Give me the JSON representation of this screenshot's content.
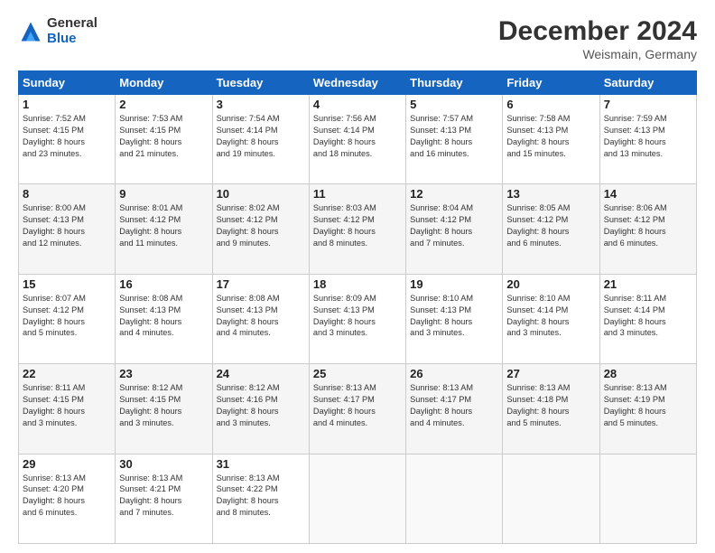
{
  "header": {
    "logo_general": "General",
    "logo_blue": "Blue",
    "month_title": "December 2024",
    "subtitle": "Weismain, Germany"
  },
  "days_of_week": [
    "Sunday",
    "Monday",
    "Tuesday",
    "Wednesday",
    "Thursday",
    "Friday",
    "Saturday"
  ],
  "weeks": [
    [
      {
        "day": "1",
        "lines": [
          "Sunrise: 7:52 AM",
          "Sunset: 4:15 PM",
          "Daylight: 8 hours",
          "and 23 minutes."
        ]
      },
      {
        "day": "2",
        "lines": [
          "Sunrise: 7:53 AM",
          "Sunset: 4:15 PM",
          "Daylight: 8 hours",
          "and 21 minutes."
        ]
      },
      {
        "day": "3",
        "lines": [
          "Sunrise: 7:54 AM",
          "Sunset: 4:14 PM",
          "Daylight: 8 hours",
          "and 19 minutes."
        ]
      },
      {
        "day": "4",
        "lines": [
          "Sunrise: 7:56 AM",
          "Sunset: 4:14 PM",
          "Daylight: 8 hours",
          "and 18 minutes."
        ]
      },
      {
        "day": "5",
        "lines": [
          "Sunrise: 7:57 AM",
          "Sunset: 4:13 PM",
          "Daylight: 8 hours",
          "and 16 minutes."
        ]
      },
      {
        "day": "6",
        "lines": [
          "Sunrise: 7:58 AM",
          "Sunset: 4:13 PM",
          "Daylight: 8 hours",
          "and 15 minutes."
        ]
      },
      {
        "day": "7",
        "lines": [
          "Sunrise: 7:59 AM",
          "Sunset: 4:13 PM",
          "Daylight: 8 hours",
          "and 13 minutes."
        ]
      }
    ],
    [
      {
        "day": "8",
        "lines": [
          "Sunrise: 8:00 AM",
          "Sunset: 4:13 PM",
          "Daylight: 8 hours",
          "and 12 minutes."
        ]
      },
      {
        "day": "9",
        "lines": [
          "Sunrise: 8:01 AM",
          "Sunset: 4:12 PM",
          "Daylight: 8 hours",
          "and 11 minutes."
        ]
      },
      {
        "day": "10",
        "lines": [
          "Sunrise: 8:02 AM",
          "Sunset: 4:12 PM",
          "Daylight: 8 hours",
          "and 9 minutes."
        ]
      },
      {
        "day": "11",
        "lines": [
          "Sunrise: 8:03 AM",
          "Sunset: 4:12 PM",
          "Daylight: 8 hours",
          "and 8 minutes."
        ]
      },
      {
        "day": "12",
        "lines": [
          "Sunrise: 8:04 AM",
          "Sunset: 4:12 PM",
          "Daylight: 8 hours",
          "and 7 minutes."
        ]
      },
      {
        "day": "13",
        "lines": [
          "Sunrise: 8:05 AM",
          "Sunset: 4:12 PM",
          "Daylight: 8 hours",
          "and 6 minutes."
        ]
      },
      {
        "day": "14",
        "lines": [
          "Sunrise: 8:06 AM",
          "Sunset: 4:12 PM",
          "Daylight: 8 hours",
          "and 6 minutes."
        ]
      }
    ],
    [
      {
        "day": "15",
        "lines": [
          "Sunrise: 8:07 AM",
          "Sunset: 4:12 PM",
          "Daylight: 8 hours",
          "and 5 minutes."
        ]
      },
      {
        "day": "16",
        "lines": [
          "Sunrise: 8:08 AM",
          "Sunset: 4:13 PM",
          "Daylight: 8 hours",
          "and 4 minutes."
        ]
      },
      {
        "day": "17",
        "lines": [
          "Sunrise: 8:08 AM",
          "Sunset: 4:13 PM",
          "Daylight: 8 hours",
          "and 4 minutes."
        ]
      },
      {
        "day": "18",
        "lines": [
          "Sunrise: 8:09 AM",
          "Sunset: 4:13 PM",
          "Daylight: 8 hours",
          "and 3 minutes."
        ]
      },
      {
        "day": "19",
        "lines": [
          "Sunrise: 8:10 AM",
          "Sunset: 4:13 PM",
          "Daylight: 8 hours",
          "and 3 minutes."
        ]
      },
      {
        "day": "20",
        "lines": [
          "Sunrise: 8:10 AM",
          "Sunset: 4:14 PM",
          "Daylight: 8 hours",
          "and 3 minutes."
        ]
      },
      {
        "day": "21",
        "lines": [
          "Sunrise: 8:11 AM",
          "Sunset: 4:14 PM",
          "Daylight: 8 hours",
          "and 3 minutes."
        ]
      }
    ],
    [
      {
        "day": "22",
        "lines": [
          "Sunrise: 8:11 AM",
          "Sunset: 4:15 PM",
          "Daylight: 8 hours",
          "and 3 minutes."
        ]
      },
      {
        "day": "23",
        "lines": [
          "Sunrise: 8:12 AM",
          "Sunset: 4:15 PM",
          "Daylight: 8 hours",
          "and 3 minutes."
        ]
      },
      {
        "day": "24",
        "lines": [
          "Sunrise: 8:12 AM",
          "Sunset: 4:16 PM",
          "Daylight: 8 hours",
          "and 3 minutes."
        ]
      },
      {
        "day": "25",
        "lines": [
          "Sunrise: 8:13 AM",
          "Sunset: 4:17 PM",
          "Daylight: 8 hours",
          "and 4 minutes."
        ]
      },
      {
        "day": "26",
        "lines": [
          "Sunrise: 8:13 AM",
          "Sunset: 4:17 PM",
          "Daylight: 8 hours",
          "and 4 minutes."
        ]
      },
      {
        "day": "27",
        "lines": [
          "Sunrise: 8:13 AM",
          "Sunset: 4:18 PM",
          "Daylight: 8 hours",
          "and 5 minutes."
        ]
      },
      {
        "day": "28",
        "lines": [
          "Sunrise: 8:13 AM",
          "Sunset: 4:19 PM",
          "Daylight: 8 hours",
          "and 5 minutes."
        ]
      }
    ],
    [
      {
        "day": "29",
        "lines": [
          "Sunrise: 8:13 AM",
          "Sunset: 4:20 PM",
          "Daylight: 8 hours",
          "and 6 minutes."
        ]
      },
      {
        "day": "30",
        "lines": [
          "Sunrise: 8:13 AM",
          "Sunset: 4:21 PM",
          "Daylight: 8 hours",
          "and 7 minutes."
        ]
      },
      {
        "day": "31",
        "lines": [
          "Sunrise: 8:13 AM",
          "Sunset: 4:22 PM",
          "Daylight: 8 hours",
          "and 8 minutes."
        ]
      },
      null,
      null,
      null,
      null
    ]
  ]
}
